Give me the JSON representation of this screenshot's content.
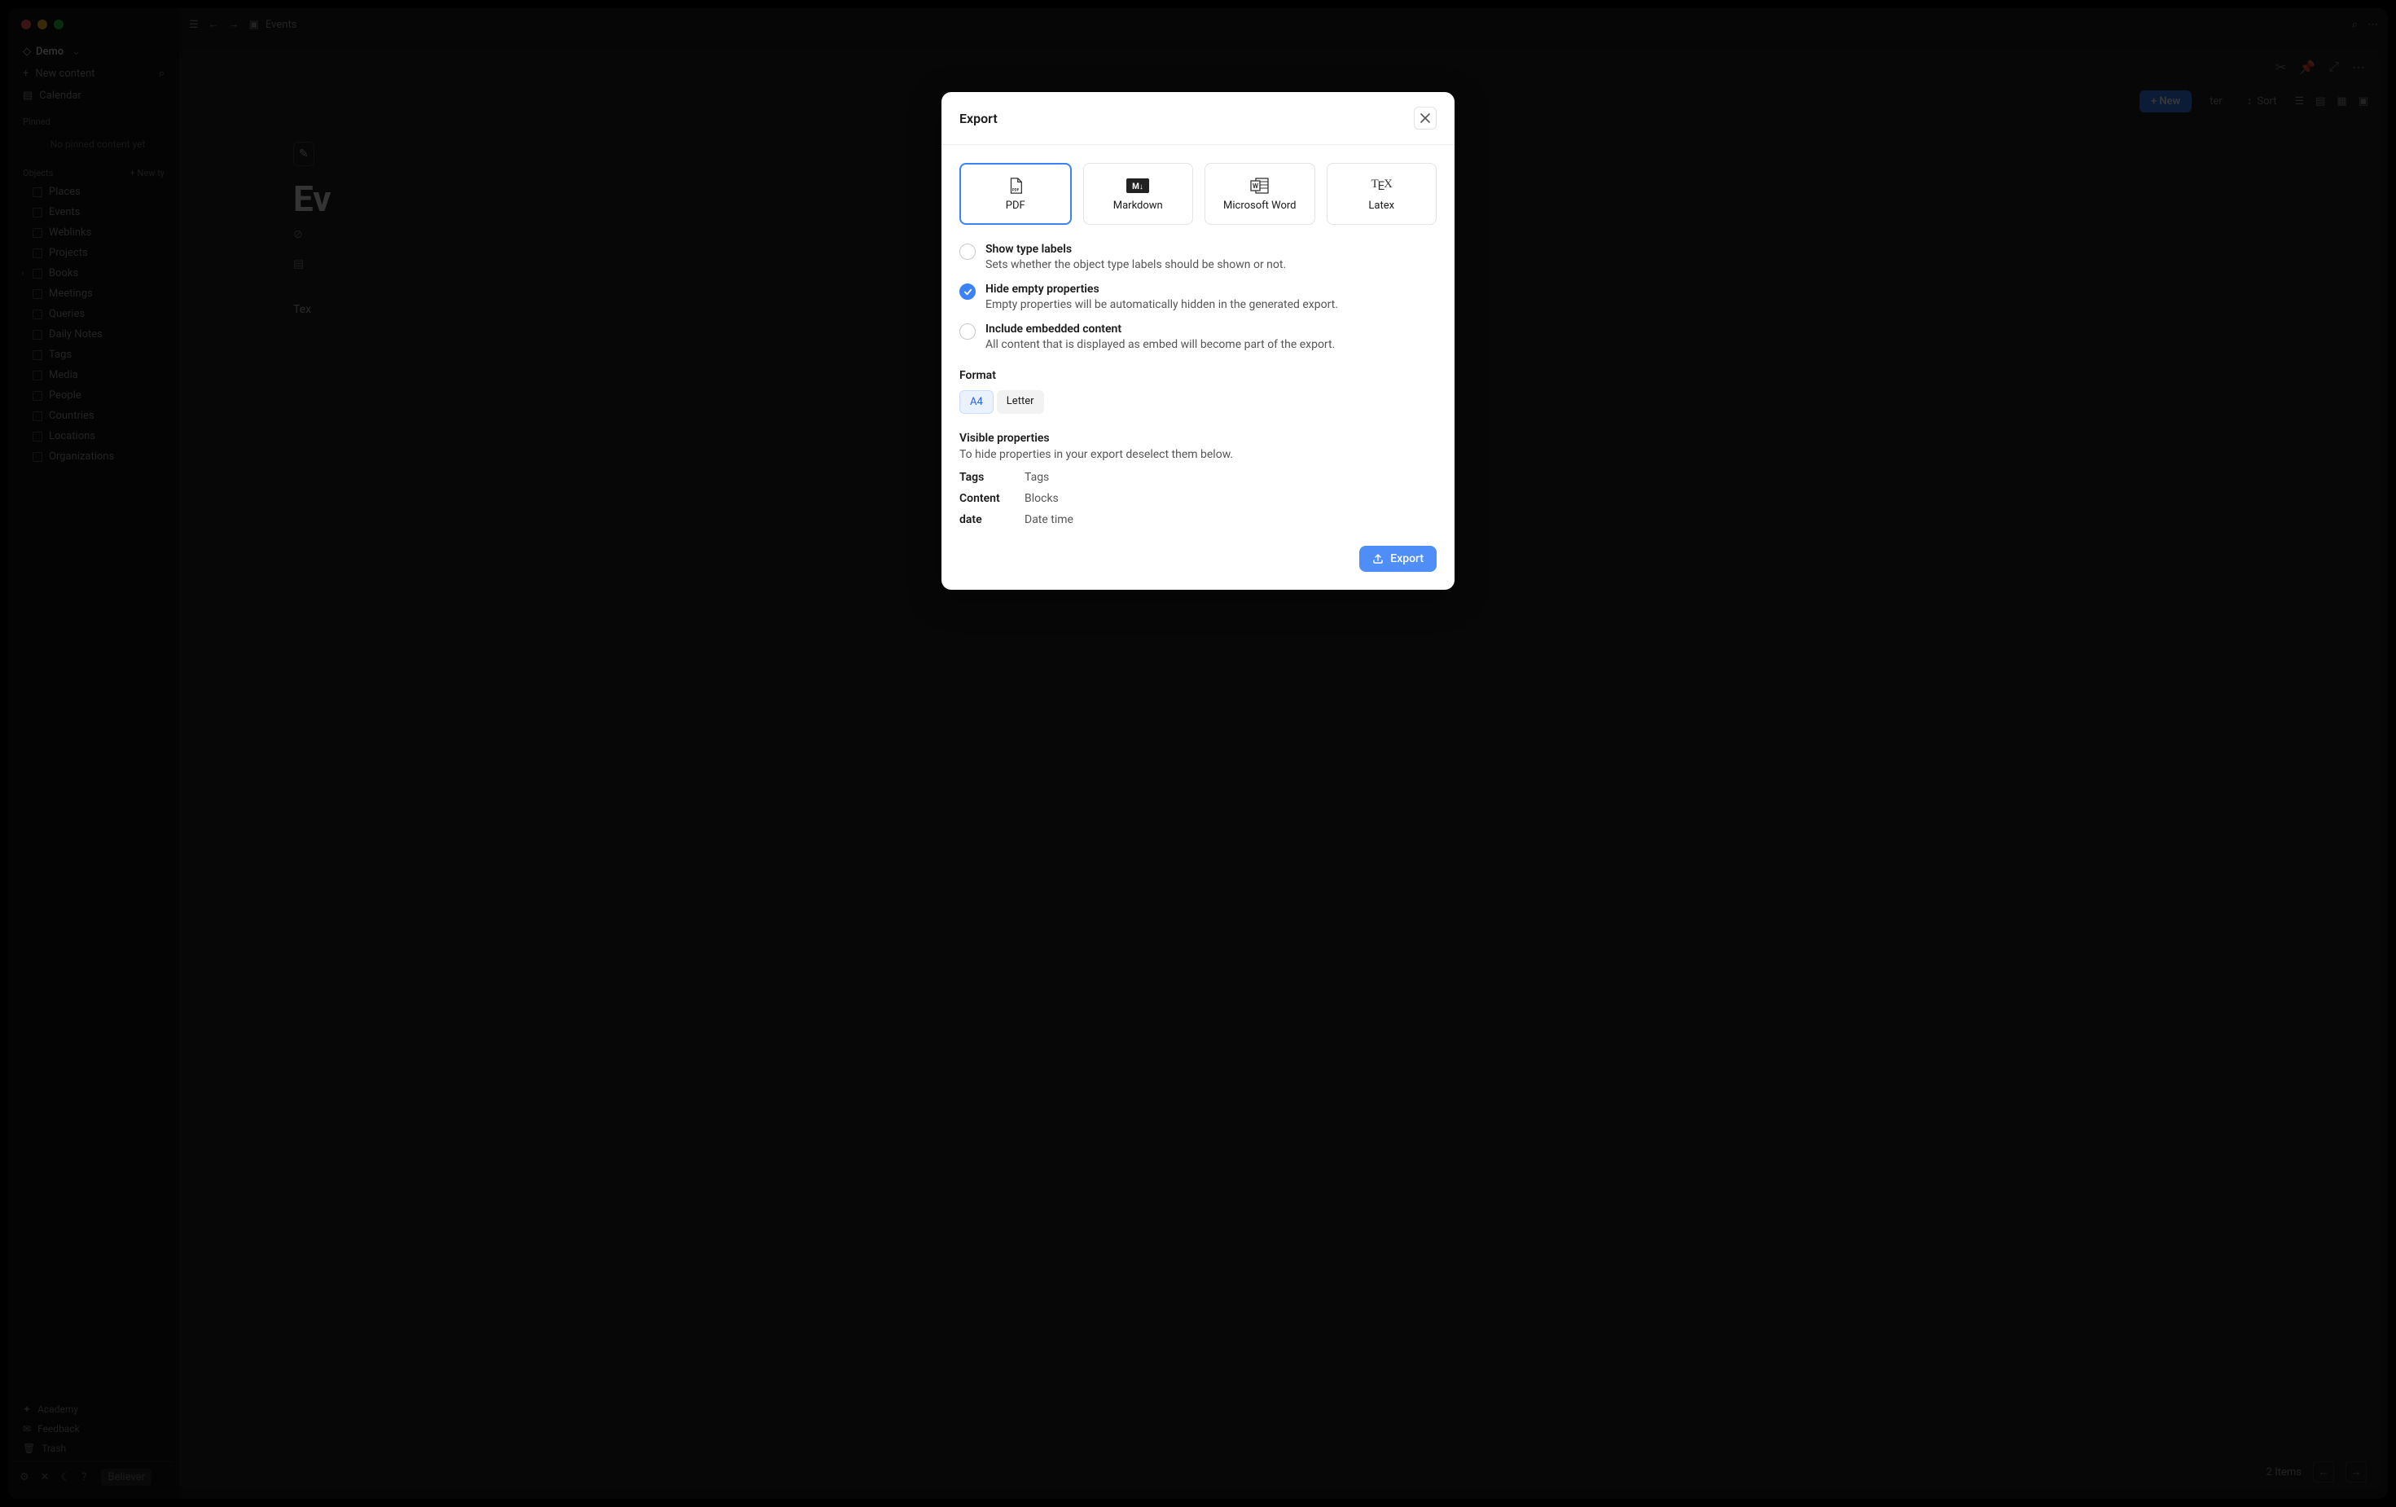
{
  "window": {
    "workspace": "Demo",
    "new_content_label": "New content",
    "calendar_label": "Calendar",
    "pinned_label": "Pinned",
    "pinned_empty": "No pinned content yet",
    "objects_label": "Objects",
    "new_type_label": "+ New ty",
    "objects": [
      "Places",
      "Events",
      "Weblinks",
      "Projects",
      "Books",
      "Meetings",
      "Queries",
      "Daily Notes",
      "Tags",
      "Media",
      "People",
      "Countries",
      "Locations",
      "Organizations"
    ],
    "footer_links": [
      "Academy",
      "Feedback",
      "Trash"
    ],
    "bottom_badge": "Believer"
  },
  "topbar": {
    "breadcrumb": "Events"
  },
  "panel": {
    "title_cut": "Ev",
    "text_body": "Tex",
    "toolbar": {
      "new": "+ New",
      "filter": "ter",
      "sort": "Sort"
    },
    "footer": {
      "count": "2 Items"
    }
  },
  "modal": {
    "title": "Export",
    "formats": [
      {
        "id": "pdf",
        "label": "PDF",
        "selected": true
      },
      {
        "id": "markdown",
        "label": "Markdown",
        "selected": false
      },
      {
        "id": "word",
        "label": "Microsoft Word",
        "selected": false
      },
      {
        "id": "latex",
        "label": "Latex",
        "selected": false
      }
    ],
    "options": [
      {
        "id": "show-type-labels",
        "title": "Show type labels",
        "desc": "Sets whether the object type labels should be shown or not.",
        "checked": false
      },
      {
        "id": "hide-empty",
        "title": "Hide empty properties",
        "desc": "Empty properties will be automatically hidden in the generated export.",
        "checked": true
      },
      {
        "id": "include-embedded",
        "title": "Include embedded content",
        "desc": "All content that is displayed as embed will become part of the export.",
        "checked": false
      }
    ],
    "page_format": {
      "label": "Format",
      "options": [
        "A4",
        "Letter"
      ],
      "selected": "A4"
    },
    "visible_props": {
      "label": "Visible properties",
      "desc": "To hide properties in your export deselect them below.",
      "rows": [
        {
          "name": "Tags",
          "type": "Tags",
          "on": true
        },
        {
          "name": "Content",
          "type": "Blocks",
          "on": true
        },
        {
          "name": "date",
          "type": "Date time",
          "on": true
        }
      ]
    },
    "export_button": "Export"
  }
}
